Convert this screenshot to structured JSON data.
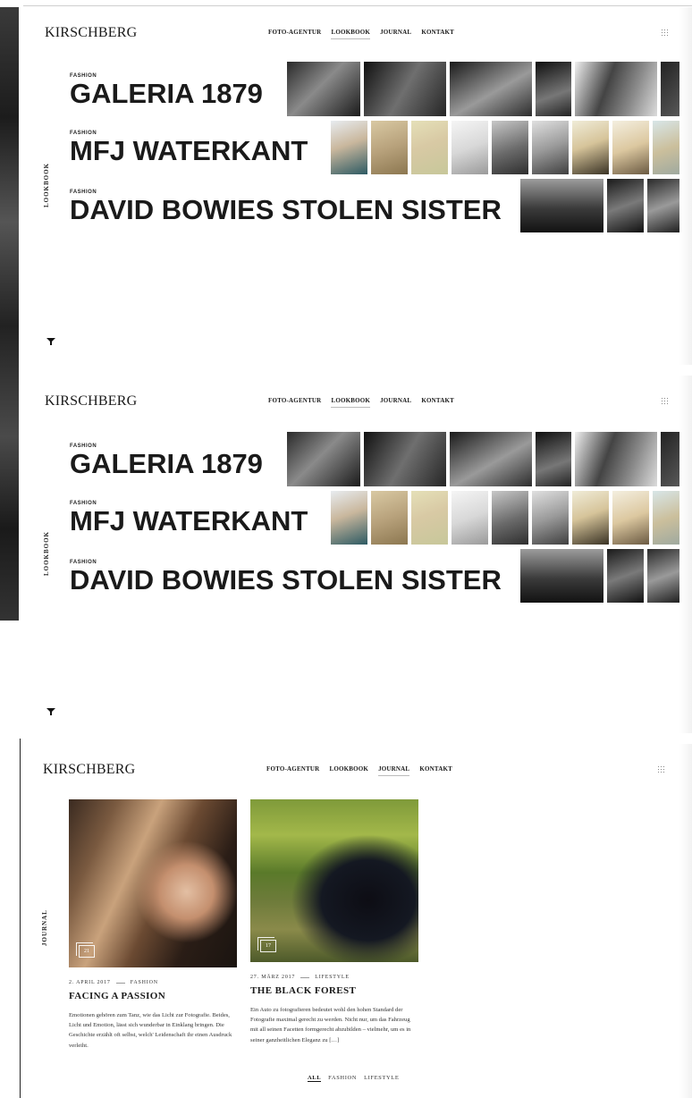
{
  "brand": "KIRSCHBERG",
  "nav": [
    "FOTO-AGENTUR",
    "LOOKBOOK",
    "JOURNAL",
    "KONTAKT"
  ],
  "lookbook": {
    "section_label": "LOOKBOOK",
    "active_nav": "LOOKBOOK",
    "entries": [
      {
        "category": "FASHION",
        "title": "GALERIA 1879"
      },
      {
        "category": "FASHION",
        "title": "MFJ WATERKANT"
      },
      {
        "category": "FASHION",
        "title": "DAVID BOWIES STOLEN SISTER"
      }
    ]
  },
  "journal": {
    "section_label": "JOURNAL",
    "active_nav": "JOURNAL",
    "posts": [
      {
        "date": "2. APRIL 2017",
        "category": "FASHION",
        "title": "FACING A PASSION",
        "photo_count": "21",
        "excerpt": "Emotionen gehören zum Tanz, wie das Licht zur Fotografie. Beides, Licht und Emotion, lässt sich wunderbar in Einklang bringen. Die Geschichte erzählt oft selbst, welch' Leidenschaft ihr einen Ausdruck verleiht."
      },
      {
        "date": "27. MÄRZ 2017",
        "category": "LIFESTYLE",
        "title": "THE BLACK FOREST",
        "photo_count": "17",
        "excerpt": "Ein Auto zu fotografieren bedeutet wohl den hohen Standard der Fotografie maximal gerecht zu werden. Nicht nur, um das Fahrzeug mit all seinen Facetten formgerecht abzubilden – vielmehr, um es in seiner ganzheitlichen Eleganz zu […]"
      }
    ],
    "filters": [
      "ALL",
      "FASHION",
      "LIFESTYLE"
    ],
    "active_filter": "ALL"
  },
  "icons": [
    "grid-icon",
    "filter-icon",
    "gallery-count-icon"
  ]
}
